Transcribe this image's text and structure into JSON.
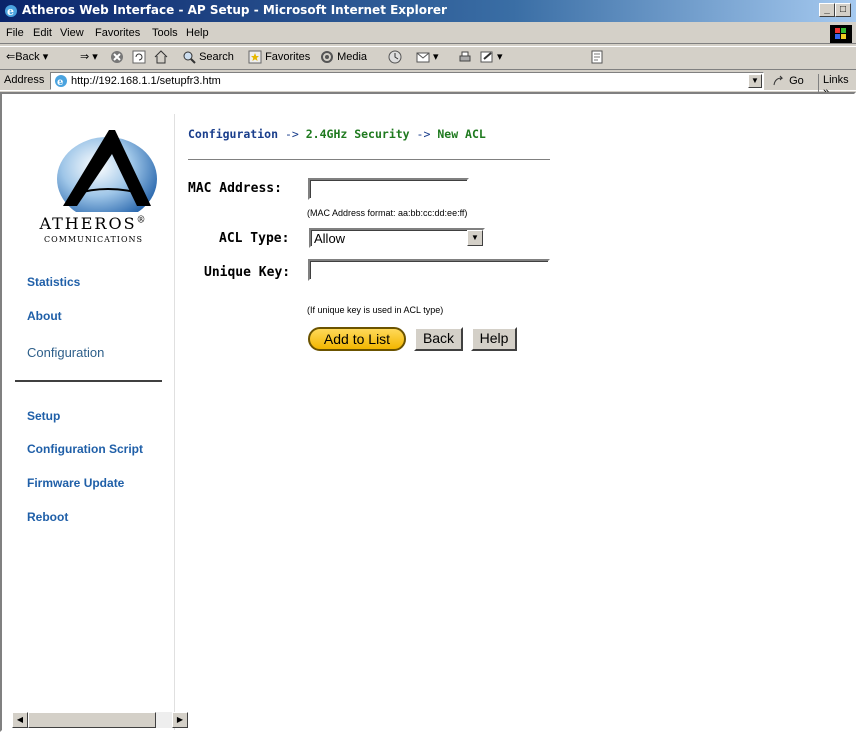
{
  "window": {
    "title": "Atheros Web Interface - AP Setup - Microsoft Internet Explorer",
    "min_label": "_",
    "max_label": "□",
    "close_label": "×"
  },
  "menu": [
    "File",
    "Edit",
    "View",
    "Favorites",
    "Tools",
    "Help"
  ],
  "toolbar": {
    "back": "⇐Back",
    "forward": "⇒",
    "search": "Search",
    "favorites": "Favorites",
    "media": "Media"
  },
  "address": {
    "label": "Address",
    "url": "http://192.168.1.1/setupfr3.htm",
    "go": "Go",
    "links": "Links"
  },
  "sidebar": {
    "brand": "ATHEROS",
    "brand_mark": "®",
    "brand_sub": "COMMUNICATIONS",
    "items": [
      {
        "label": "Statistics"
      },
      {
        "label": "About"
      },
      {
        "label": "Configuration"
      },
      {
        "label": "Setup"
      },
      {
        "label": "Configuration Script"
      },
      {
        "label": "Firmware Update"
      },
      {
        "label": "Reboot"
      }
    ]
  },
  "breadcrumb": {
    "config": "Configuration",
    "arrow": "->",
    "security": "2.4GHz Security",
    "current": "New ACL"
  },
  "form": {
    "mac_label": "MAC Address:",
    "mac_value": "",
    "mac_hint": "(MAC Address format: aa:bb:cc:dd:ee:ff)",
    "acl_label": "ACL Type:",
    "acl_value": "Allow",
    "key_label": "Unique Key:",
    "key_value": "",
    "key_hint": "(If unique key is used in ACL type)"
  },
  "buttons": {
    "add": "Add to List",
    "back": "Back",
    "help": "Help"
  }
}
